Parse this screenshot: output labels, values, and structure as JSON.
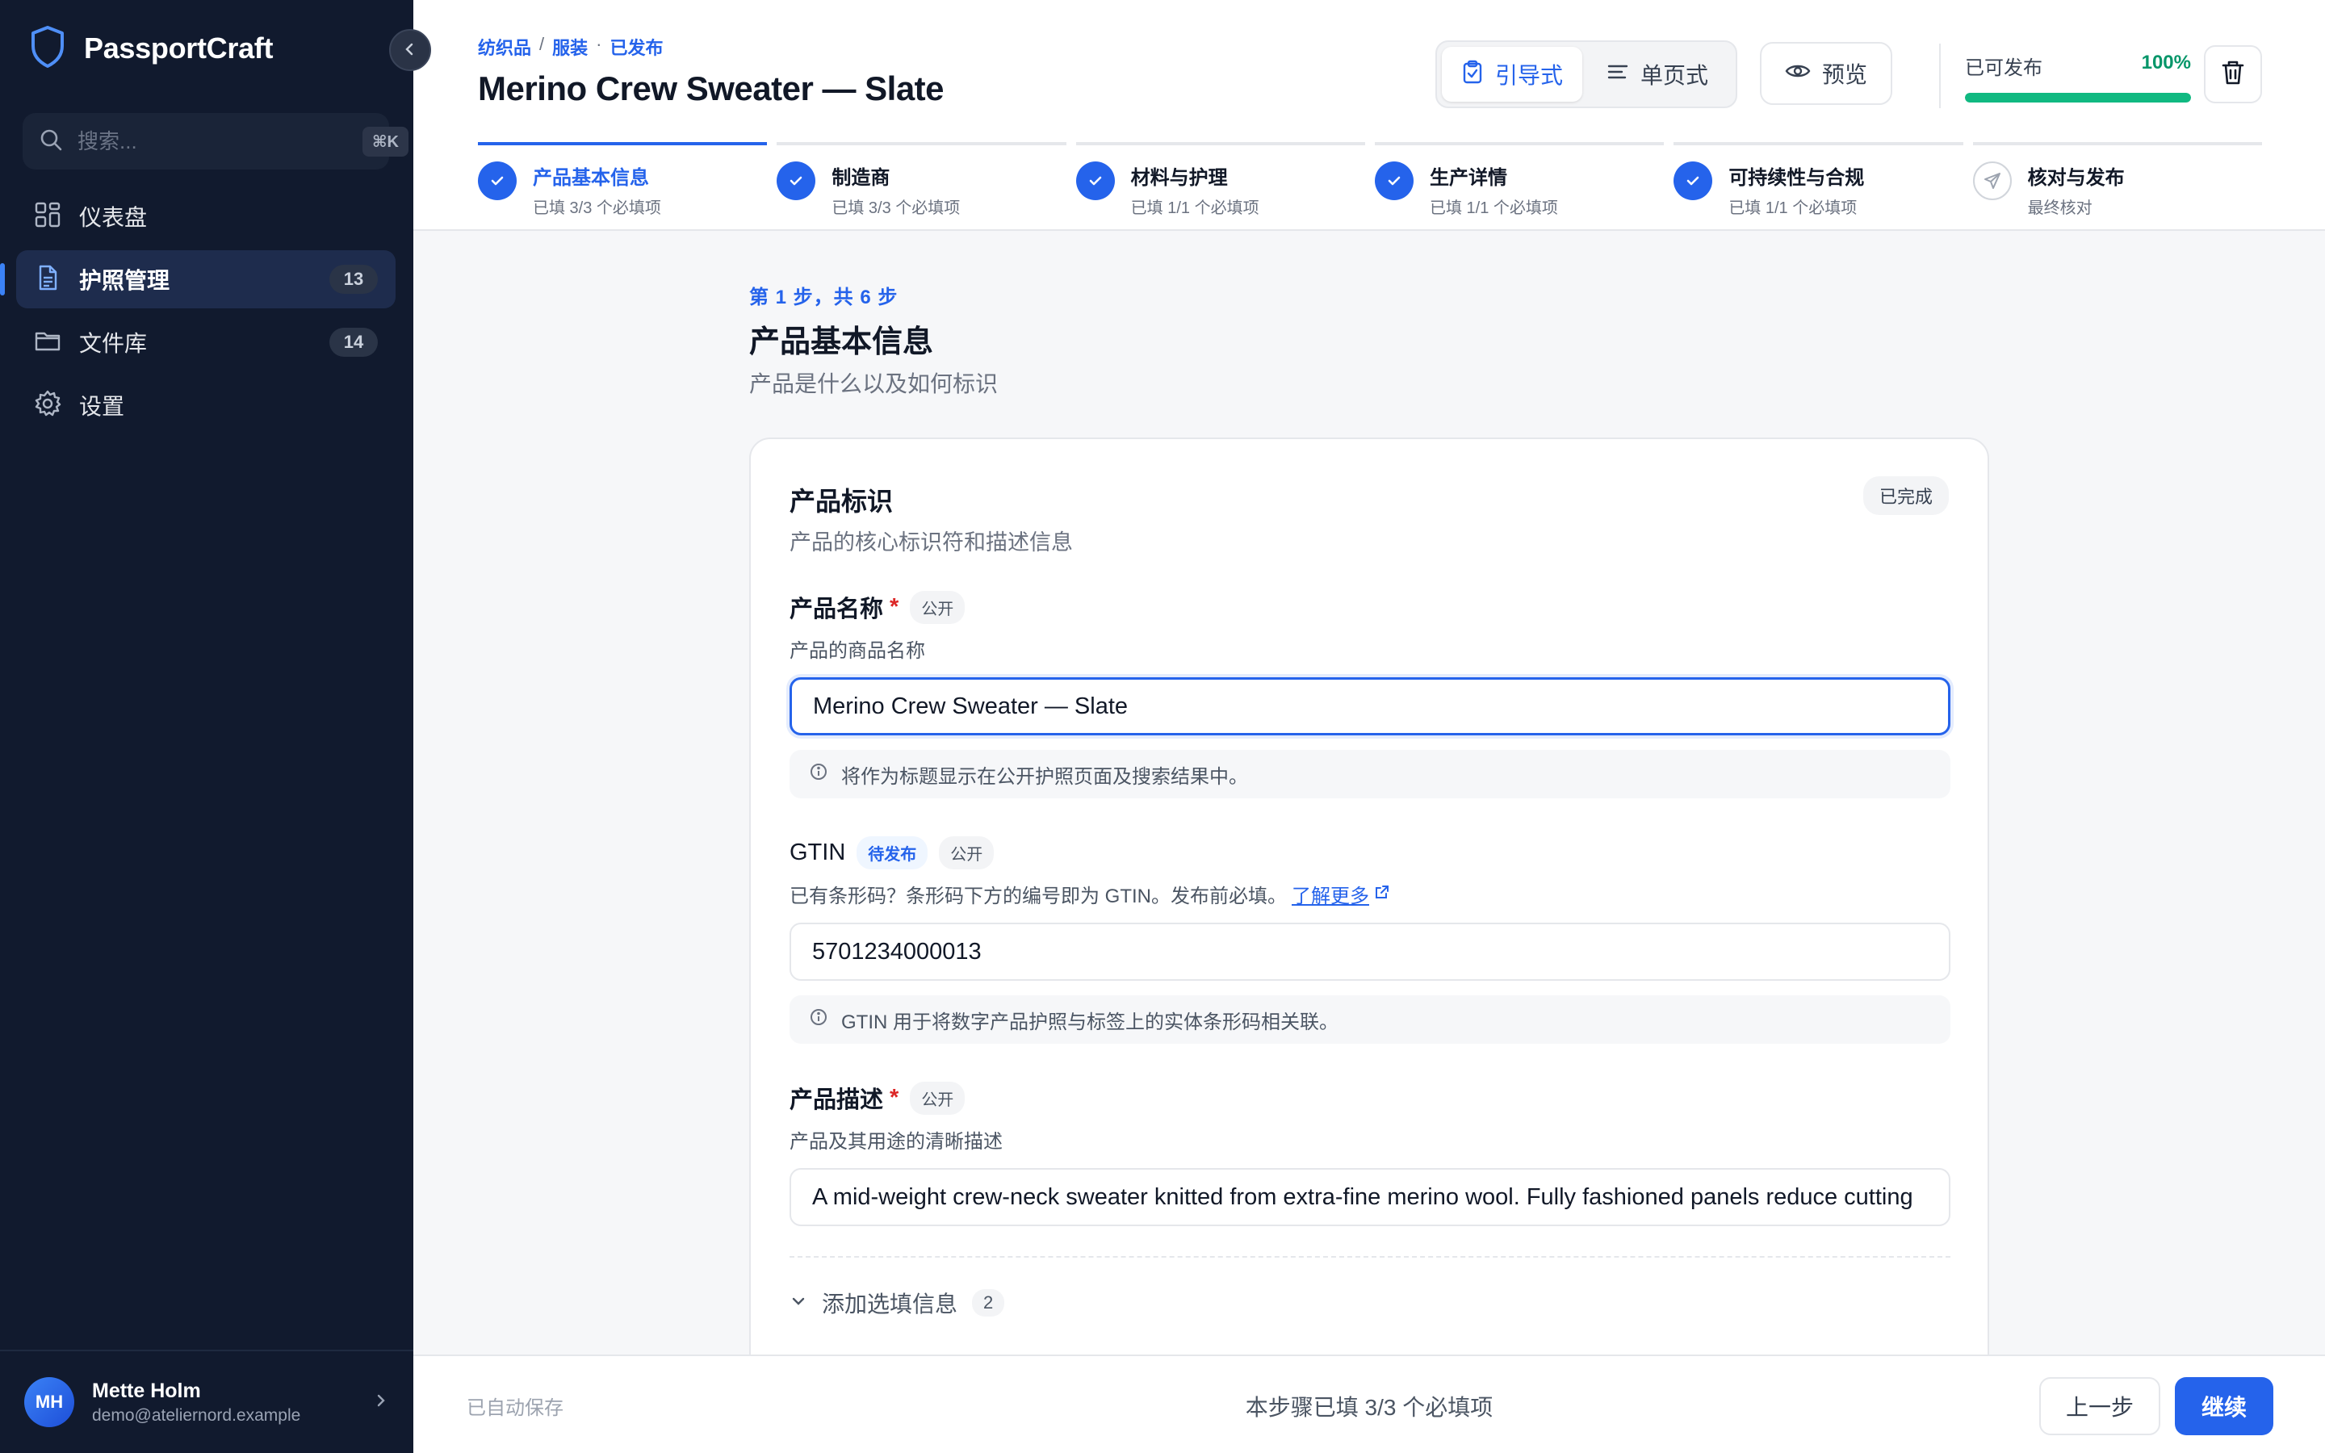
{
  "app": {
    "name": "PassportCraft"
  },
  "sidebar": {
    "search_placeholder": "搜索...",
    "search_shortcut": "⌘K",
    "items": [
      {
        "label": "仪表盘",
        "icon": "dashboard-icon",
        "count": null
      },
      {
        "label": "护照管理",
        "icon": "document-icon",
        "count": "13",
        "active": true
      },
      {
        "label": "文件库",
        "icon": "folder-icon",
        "count": "14"
      },
      {
        "label": "设置",
        "icon": "gear-icon",
        "count": null
      }
    ],
    "user": {
      "initials": "MH",
      "name": "Mette Holm",
      "email": "demo@ateliernord.example"
    }
  },
  "header": {
    "breadcrumb": [
      "纺织品",
      "服装",
      "已发布"
    ],
    "breadcrumb_sep1": "/",
    "breadcrumb_sep2": "·",
    "title": "Merino Crew Sweater — Slate",
    "modes": {
      "guided": "引导式",
      "single": "单页式"
    },
    "preview": "预览",
    "publish_label": "已可发布",
    "publish_percent": "100%",
    "publish_fraction": 1.0
  },
  "steps": [
    {
      "title": "产品基本信息",
      "sub": "已填 3/3 个必填项",
      "status": "done",
      "current": true
    },
    {
      "title": "制造商",
      "sub": "已填 3/3 个必填项",
      "status": "done"
    },
    {
      "title": "材料与护理",
      "sub": "已填 1/1 个必填项",
      "status": "done"
    },
    {
      "title": "生产详情",
      "sub": "已填 1/1 个必填项",
      "status": "done"
    },
    {
      "title": "可持续性与合规",
      "sub": "已填 1/1 个必填项",
      "status": "done"
    },
    {
      "title": "核对与发布",
      "sub": "最终核对",
      "status": "pending"
    }
  ],
  "main": {
    "kicker": "第 1 步，共 6 步",
    "title": "产品基本信息",
    "subtitle": "产品是什么以及如何标识",
    "card": {
      "title": "产品标识",
      "subtitle": "产品的核心标识符和描述信息",
      "badge": "已完成",
      "fields": {
        "name": {
          "label": "产品名称",
          "required": "*",
          "tag": "公开",
          "help": "产品的商品名称",
          "value": "Merino Crew Sweater — Slate",
          "hint": "将作为标题显示在公开护照页面及搜索结果中。"
        },
        "gtin": {
          "label": "GTIN",
          "status_tag": "待发布",
          "tag": "公开",
          "help": "已有条形码？条形码下方的编号即为 GTIN。发布前必填。",
          "link": "了解更多",
          "value": "5701234000013",
          "hint": "GTIN 用于将数字产品护照与标签上的实体条形码相关联。"
        },
        "description": {
          "label": "产品描述",
          "required": "*",
          "tag": "公开",
          "help": "产品及其用途的清晰描述",
          "value": "A mid-weight crew-neck sweater knitted from extra-fine merino wool. Fully fashioned panels reduce cutting"
        }
      },
      "optional": {
        "label": "添加选填信息",
        "count": "2"
      }
    }
  },
  "footer": {
    "autosave": "已自动保存",
    "status": "本步骤已填 3/3 个必填项",
    "prev": "上一步",
    "next": "继续"
  },
  "colors": {
    "accent": "#2563eb",
    "sidebar": "#111a2e",
    "success": "#10b981",
    "required": "#dc2626"
  }
}
